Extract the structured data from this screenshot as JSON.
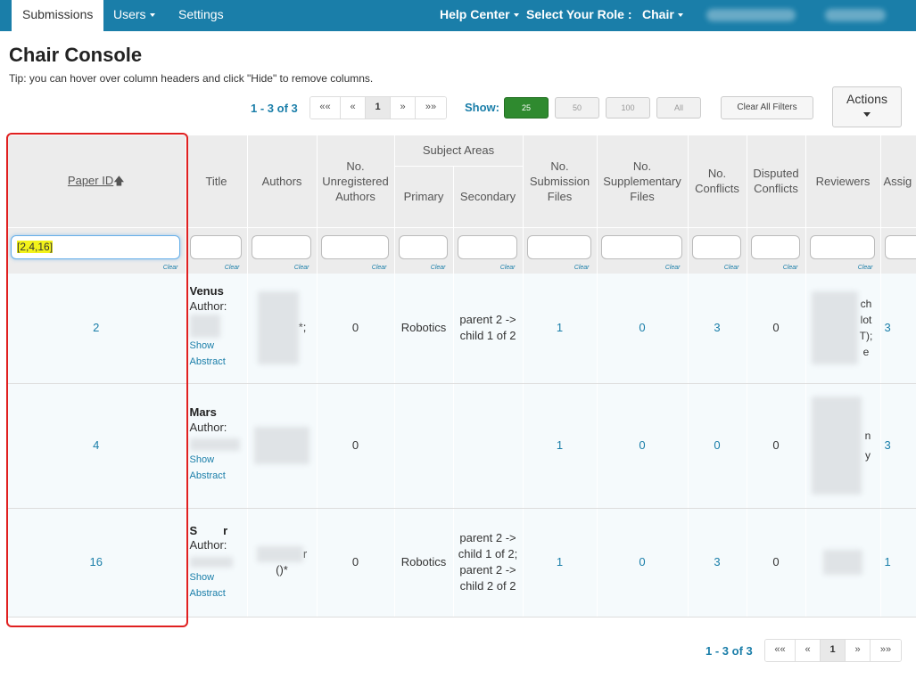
{
  "nav": {
    "tabs": [
      {
        "label": "Submissions"
      },
      {
        "label": "Users"
      },
      {
        "label": "Settings"
      }
    ],
    "help_center": "Help Center",
    "select_role_label": "Select Your Role :",
    "role": "Chair"
  },
  "page": {
    "title": "Chair Console",
    "tip": "Tip: you can hover over column headers and click \"Hide\" to remove columns."
  },
  "pager": {
    "range_text": "1 - 3 of 3",
    "first": "««",
    "prev": "«",
    "current": "1",
    "next": "»",
    "last": "»»"
  },
  "show": {
    "label": "Show:",
    "options": [
      "25",
      "50",
      "100",
      "All"
    ],
    "selected": "25"
  },
  "buttons": {
    "clear_all_filters": "Clear All Filters",
    "actions": "Actions"
  },
  "table": {
    "headers": {
      "paper_id": "Paper ID",
      "title": "Title",
      "authors": "Authors",
      "unregistered": "No. Unregistered Authors",
      "subject_areas": "Subject Areas",
      "primary": "Primary",
      "secondary": "Secondary",
      "submission_files": "No. Submission Files",
      "supplementary_files": "No. Supplementary Files",
      "conflicts": "No. Conflicts",
      "disputed": "Disputed Conflicts",
      "reviewers": "Reviewers",
      "assigned": "Assig"
    },
    "filter_clear_label": "Clear",
    "paper_id_filter_value": "[2,4,16]",
    "rows": [
      {
        "paper_id": "2",
        "title_snippet": "Venus",
        "author_label": "Author:",
        "authors_suffix": "*;",
        "unregistered": "0",
        "primary": "Robotics",
        "secondary": "parent 2 -> child 1 of 2",
        "submission_files": "1",
        "supplementary_files": "0",
        "conflicts": "3",
        "disputed": "0",
        "reviewers_partial": "ch lot T); e",
        "assigned": "3"
      },
      {
        "paper_id": "4",
        "title_snippet": "Mars",
        "author_label": "Author:",
        "authors_suffix": "",
        "unregistered": "0",
        "primary": "",
        "secondary": "",
        "submission_files": "1",
        "supplementary_files": "0",
        "conflicts": "0",
        "disputed": "0",
        "reviewers_partial": "n y",
        "assigned": "3"
      },
      {
        "paper_id": "16",
        "title_snippet": "S        r",
        "author_label": "Author:",
        "authors_suffix": "r ()*",
        "unregistered": "0",
        "primary": "Robotics",
        "secondary": "parent 2 -> child 1 of 2; parent 2 -> child 2 of 2",
        "submission_files": "1",
        "supplementary_files": "0",
        "conflicts": "3",
        "disputed": "0",
        "reviewers_partial": "",
        "assigned": "1"
      }
    ],
    "show_abstract": "Show Abstract"
  },
  "colors": {
    "nav_bg": "#1a7ea9",
    "accent": "#1a7ea9",
    "active_show": "#2f8a2f",
    "highlight_frame": "#e02020",
    "filter_highlight": "#f2f21a"
  }
}
